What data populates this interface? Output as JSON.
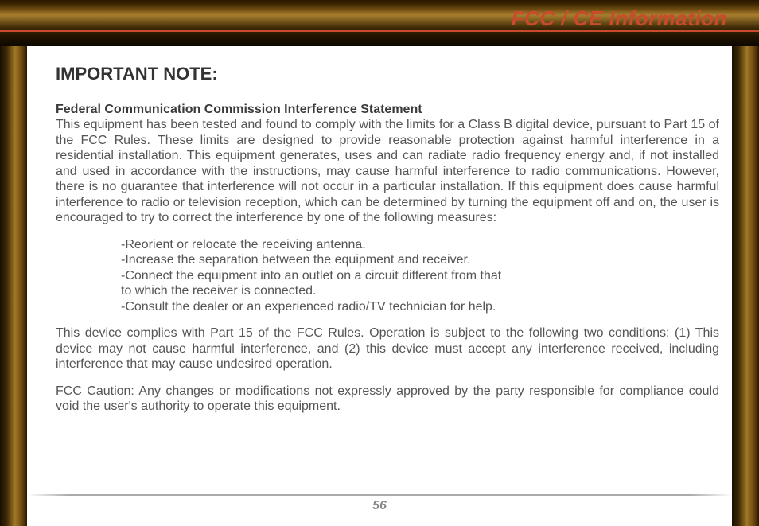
{
  "header": {
    "title": "FCC / CE Information"
  },
  "content": {
    "important_note": "IMPORTANT NOTE:",
    "subheading": "Federal Communication Commission Interference Statement",
    "para1": "This equipment has been tested and found to comply with the limits for a Class B digital device, pursuant to Part 15 of the FCC Rules.  These limits are designed to provide reasonable protection against harmful interference in a residential installation.  This equipment generates, uses and can radiate radio frequency energy and, if not installed and used in accordance with the instructions, may cause harmful interference to radio communications.  However, there is no guarantee that interference will not occur in a particular installation.  If this equipment does cause harmful interference to radio or television reception, which can be determined by turning the equipment off and on, the user is encouraged to try to correct the interference by one of the following measures:",
    "measures": [
      "-Reorient or relocate the receiving antenna.",
      "-Increase the separation between the equipment and receiver.",
      "-Connect the equipment into an outlet on a circuit different from that",
      " to which the receiver is connected.",
      "-Consult the dealer or an experienced radio/TV technician for help."
    ],
    "para2": "This device complies with Part 15 of the FCC Rules. Operation is subject to the following two conditions: (1) This device may not cause harmful interference, and (2) this device must accept any interference received, including interference that may cause undesired operation.",
    "para3": "FCC Caution: Any changes or modifications not expressly approved by the party responsible for compliance could void the user's authority to operate this equipment."
  },
  "footer": {
    "page_number": "56"
  }
}
